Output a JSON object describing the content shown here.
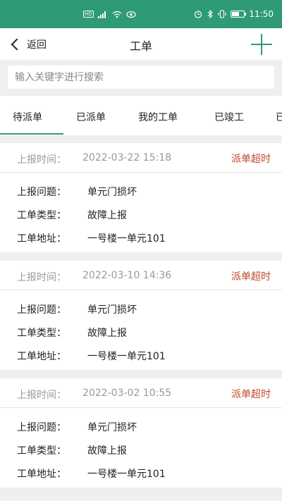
{
  "status_bar": {
    "left_icons": [
      "hd-icon",
      "signal-icon",
      "wifi-icon",
      "eye-icon"
    ],
    "right_icons": [
      "alarm-icon",
      "bluetooth-icon",
      "vibrate-icon"
    ],
    "battery_level": 0.6,
    "time": "11:50"
  },
  "nav": {
    "back_label": "返回",
    "title": "工单",
    "add_icon": "plus-icon"
  },
  "search": {
    "placeholder": "输入关键字进行搜索"
  },
  "tabs": [
    "待派单",
    "已派单",
    "我的工单",
    "已竣工",
    "已"
  ],
  "active_tab": 0,
  "labels": {
    "report_time": "上报时间：",
    "problem": "上报问题：",
    "type": "工单类型：",
    "address": "工单地址："
  },
  "cards": [
    {
      "time": "2022-03-22 15:18",
      "status": "派单超时",
      "problem": "单元门损坏",
      "type": "故障上报",
      "address": "一号楼一单元101"
    },
    {
      "time": "2022-03-10 14:36",
      "status": "派单超时",
      "problem": "单元门损坏",
      "type": "故障上报",
      "address": "一号楼一单元101"
    },
    {
      "time": "2022-03-02 10:55",
      "status": "派单超时",
      "problem": "单元门损坏",
      "type": "故障上报",
      "address": "一号楼一单元101"
    }
  ],
  "colors": {
    "brand": "#2f9a76",
    "status_warning": "#c0482b"
  }
}
